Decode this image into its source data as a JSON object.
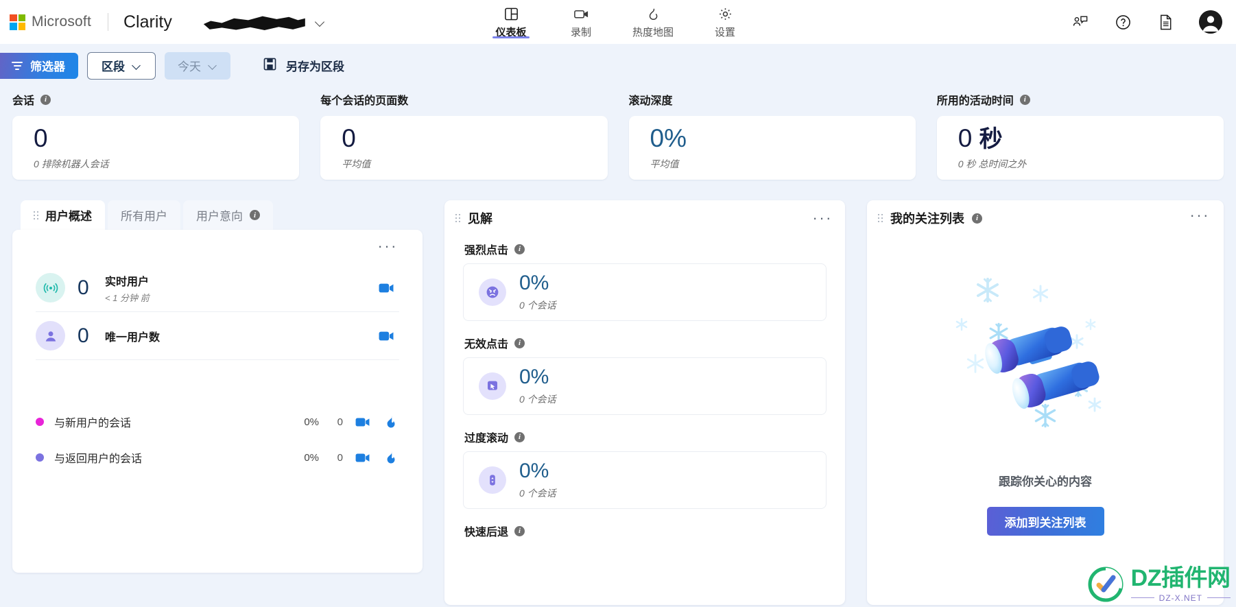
{
  "header": {
    "brand": "Microsoft",
    "app_name": "Clarity",
    "project_redacted": true,
    "nav": [
      {
        "label": "仪表板",
        "icon": "dashboard-icon",
        "active": true
      },
      {
        "label": "录制",
        "icon": "video-camera-icon",
        "active": false
      },
      {
        "label": "热度地图",
        "icon": "flame-icon",
        "active": false
      },
      {
        "label": "设置",
        "icon": "gear-icon",
        "active": false
      }
    ],
    "right_icons": [
      "feedback-person-icon",
      "help-question-icon",
      "document-icon",
      "user-avatar"
    ]
  },
  "toolbar": {
    "filter_label": "筛选器",
    "segment_label": "区段",
    "date_label": "今天",
    "save_segment_label": "另存为区段"
  },
  "kpis": [
    {
      "title": "会话",
      "value": "0",
      "unit": "",
      "sub": "0 排除机器人会话",
      "blue": false,
      "info": true
    },
    {
      "title": "每个会话的页面数",
      "value": "0",
      "unit": "",
      "sub": "平均值",
      "blue": false,
      "info": false
    },
    {
      "title": "滚动深度",
      "value": "0%",
      "unit": "",
      "sub": "平均值",
      "blue": true,
      "info": false
    },
    {
      "title": "所用的活动时间",
      "value": "0",
      "unit": "秒",
      "sub": "0 秒 总时间之外",
      "blue": false,
      "info": true
    }
  ],
  "user_panel": {
    "tabs": [
      {
        "label": "用户概述",
        "active": true,
        "info": false
      },
      {
        "label": "所有用户",
        "active": false,
        "info": false
      },
      {
        "label": "用户意向",
        "active": false,
        "info": true
      }
    ],
    "menu": "···",
    "stats": [
      {
        "num": "0",
        "label": "实时用户",
        "sub": "< 1 分钟 前",
        "icon": "signal-live-icon",
        "bubble": "teal",
        "action": "play-recording-icon"
      },
      {
        "num": "0",
        "label": "唯一用户数",
        "sub": "",
        "icon": "person-icon",
        "bubble": "lilac",
        "action": "play-recording-icon"
      }
    ],
    "legend": [
      {
        "label": "与新用户的会话",
        "pct": "0%",
        "count": "0",
        "color": "#e824d8",
        "actions": [
          "play-recording-icon",
          "flame-heatmap-icon"
        ]
      },
      {
        "label": "与返回用户的会话",
        "pct": "0%",
        "count": "0",
        "color": "#7b72e0",
        "actions": [
          "play-recording-icon",
          "flame-heatmap-icon"
        ]
      }
    ]
  },
  "insights_panel": {
    "title": "见解",
    "menu": "···",
    "items": [
      {
        "label": "强烈点击",
        "pct": "0%",
        "sub": "0 个会话",
        "icon": "angry-face-icon",
        "info": true
      },
      {
        "label": "无效点击",
        "pct": "0%",
        "sub": "0 个会话",
        "icon": "dead-click-cursor-icon",
        "info": true
      },
      {
        "label": "过度滚动",
        "pct": "0%",
        "sub": "0 个会话",
        "icon": "excessive-scroll-icon",
        "info": true
      },
      {
        "label": "快速后退",
        "pct": "",
        "sub": "",
        "icon": "quick-back-icon",
        "info": true
      }
    ]
  },
  "watchlist_panel": {
    "title": "我的关注列表",
    "menu": "···",
    "info": true,
    "empty_text": "跟踪你关心的内容",
    "cta_label": "添加到关注列表",
    "art": "binoculars-snowflakes-illustration"
  },
  "watermark": {
    "main": "DZ插件网",
    "sub": "DZ-X.NET"
  },
  "colors": {
    "accent_blue": "#2f7ee0",
    "accent_purple": "#7b83eb",
    "kpi_value": "#141b41",
    "kpi_blue": "#1f5d8c",
    "page_bg": "#eef3fb",
    "new_user_dot": "#e824d8",
    "return_user_dot": "#7b72e0"
  }
}
